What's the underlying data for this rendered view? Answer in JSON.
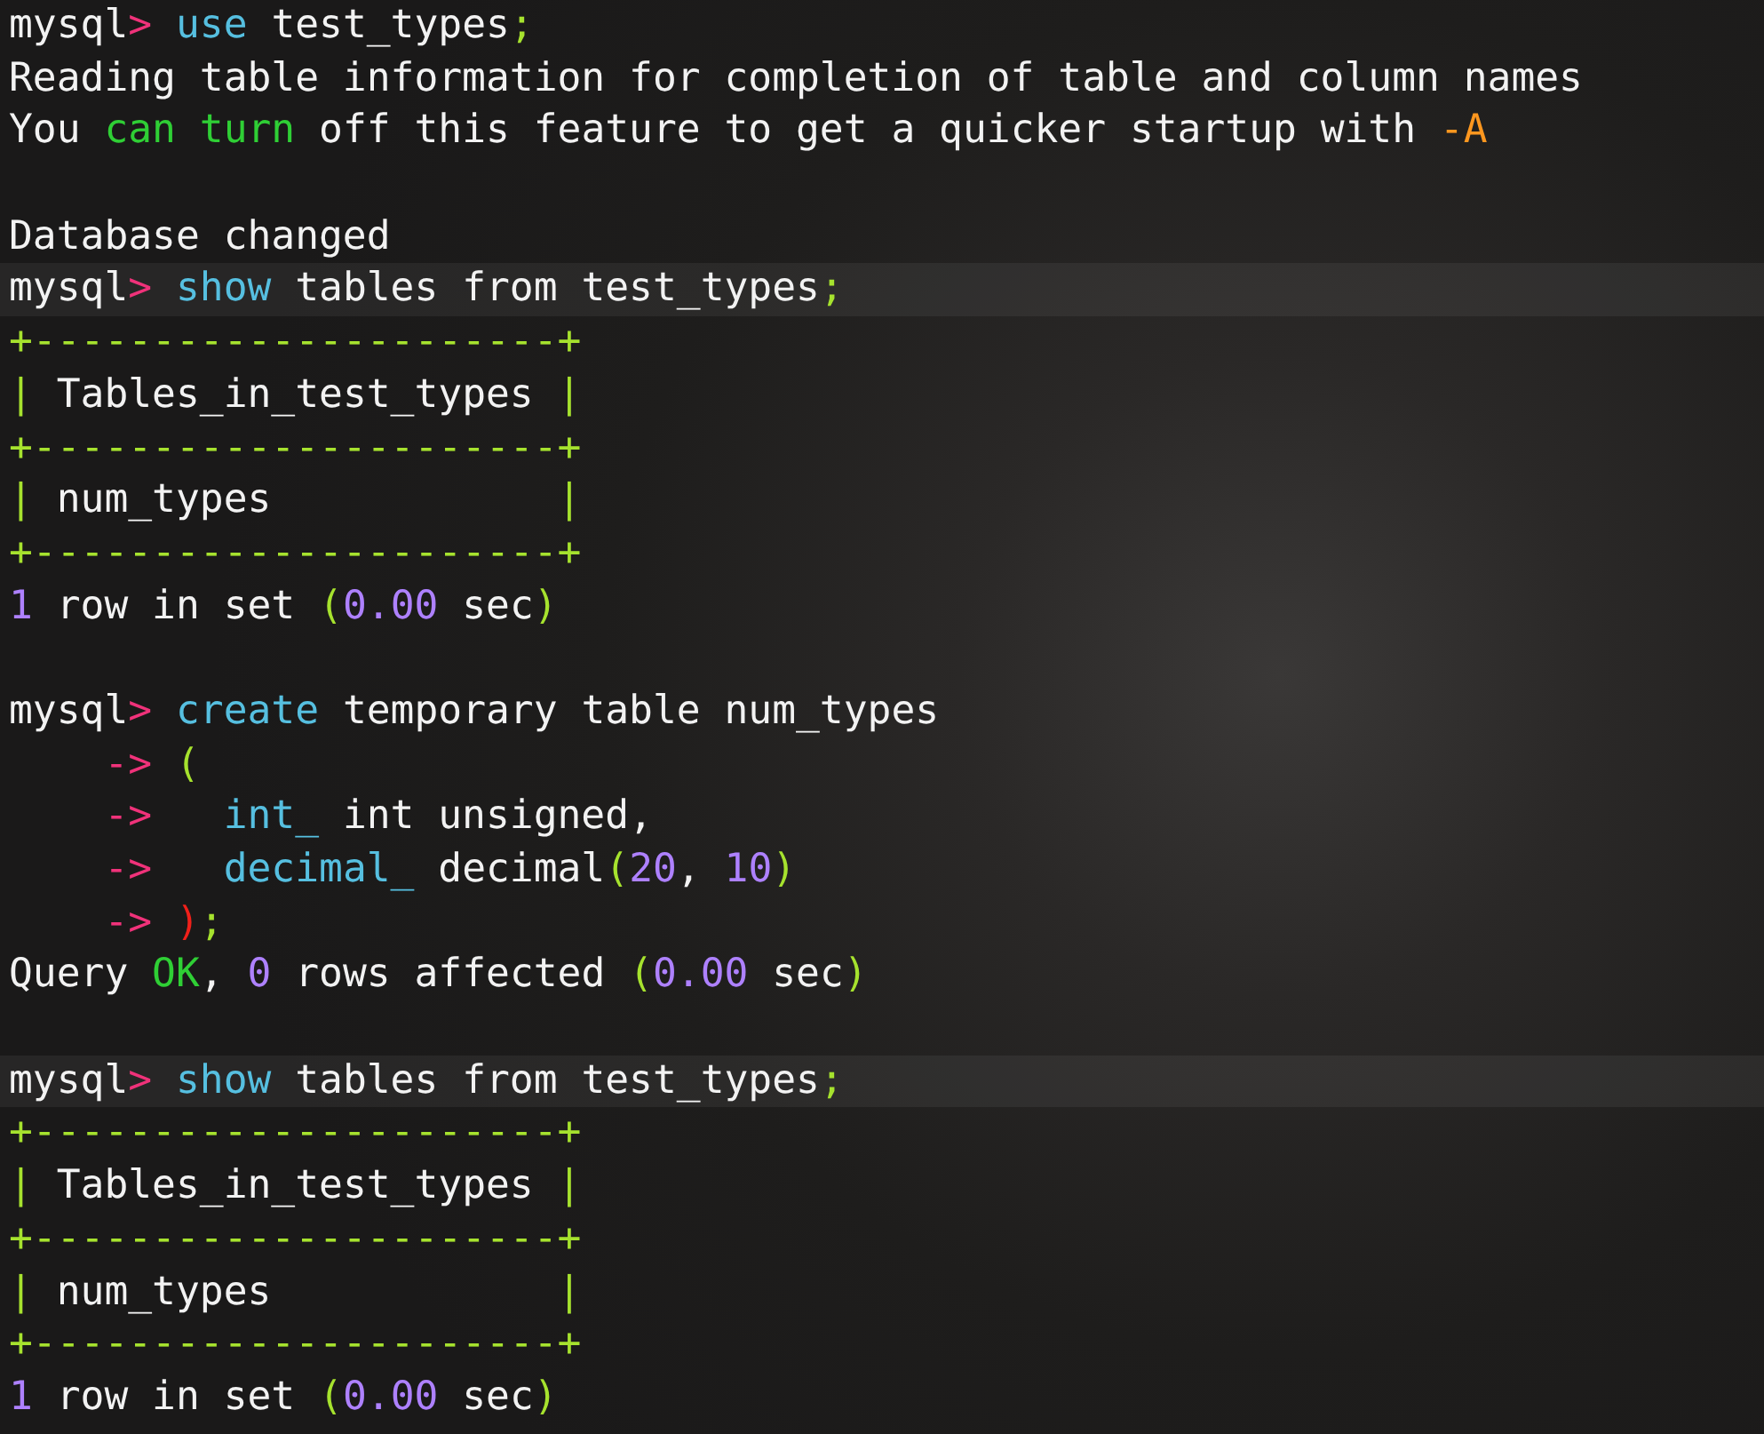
{
  "terminal": {
    "lines": [
      {
        "kind": "code",
        "highlighted": false,
        "segments": [
          {
            "kind": "text",
            "text": "mysql"
          },
          {
            "kind": "prompt",
            "text": ">"
          },
          {
            "kind": "keyword",
            "text": " use"
          },
          {
            "kind": "text",
            "text": " test_types"
          },
          {
            "kind": "punct",
            "text": ";"
          }
        ]
      },
      {
        "kind": "code",
        "highlighted": false,
        "segments": [
          {
            "kind": "text",
            "text": "Reading table information for completion of table and column names"
          }
        ]
      },
      {
        "kind": "code",
        "highlighted": false,
        "segments": [
          {
            "kind": "text",
            "text": "You "
          },
          {
            "kind": "ok",
            "text": "can"
          },
          {
            "kind": "ok",
            "text": " turn"
          },
          {
            "kind": "text",
            "text": " off this feature to get a quicker startup with "
          },
          {
            "kind": "warn",
            "text": "-A"
          }
        ]
      },
      {
        "kind": "blank"
      },
      {
        "kind": "code",
        "highlighted": false,
        "segments": [
          {
            "kind": "text",
            "text": "Database changed"
          }
        ]
      },
      {
        "kind": "code",
        "highlighted": true,
        "segments": [
          {
            "kind": "text",
            "text": "mysql"
          },
          {
            "kind": "prompt",
            "text": ">"
          },
          {
            "kind": "keyword",
            "text": " show"
          },
          {
            "kind": "text",
            "text": " tables from test_types"
          },
          {
            "kind": "punct",
            "text": ";"
          }
        ]
      },
      {
        "kind": "code",
        "highlighted": false,
        "segments": [
          {
            "kind": "border",
            "text": "+----------------------+"
          }
        ]
      },
      {
        "kind": "code",
        "highlighted": false,
        "segments": [
          {
            "kind": "border",
            "text": "|"
          },
          {
            "kind": "text",
            "text": " Tables_in_test_types "
          },
          {
            "kind": "border",
            "text": "|"
          }
        ]
      },
      {
        "kind": "code",
        "highlighted": false,
        "segments": [
          {
            "kind": "border",
            "text": "+----------------------+"
          }
        ]
      },
      {
        "kind": "code",
        "highlighted": false,
        "segments": [
          {
            "kind": "border",
            "text": "|"
          },
          {
            "kind": "text",
            "text": " num_types            "
          },
          {
            "kind": "border",
            "text": "|"
          }
        ]
      },
      {
        "kind": "code",
        "highlighted": false,
        "segments": [
          {
            "kind": "border",
            "text": "+----------------------+"
          }
        ]
      },
      {
        "kind": "code",
        "highlighted": false,
        "segments": [
          {
            "kind": "number",
            "text": "1"
          },
          {
            "kind": "text",
            "text": " row in set "
          },
          {
            "kind": "punct",
            "text": "("
          },
          {
            "kind": "number",
            "text": "0.00"
          },
          {
            "kind": "text",
            "text": " sec"
          },
          {
            "kind": "punct",
            "text": ")"
          }
        ]
      },
      {
        "kind": "blank"
      },
      {
        "kind": "code",
        "highlighted": false,
        "segments": [
          {
            "kind": "text",
            "text": "mysql"
          },
          {
            "kind": "prompt",
            "text": ">"
          },
          {
            "kind": "keyword",
            "text": " create"
          },
          {
            "kind": "text",
            "text": " temporary table num_types"
          }
        ]
      },
      {
        "kind": "code",
        "highlighted": false,
        "segments": [
          {
            "kind": "prompt",
            "text": "    ->"
          },
          {
            "kind": "punct",
            "text": " ("
          }
        ]
      },
      {
        "kind": "code",
        "highlighted": false,
        "segments": [
          {
            "kind": "prompt",
            "text": "    ->"
          },
          {
            "kind": "keyword",
            "text": "   int_"
          },
          {
            "kind": "text",
            "text": " int unsigned,"
          }
        ]
      },
      {
        "kind": "code",
        "highlighted": false,
        "segments": [
          {
            "kind": "prompt",
            "text": "    ->"
          },
          {
            "kind": "keyword",
            "text": "   decimal_"
          },
          {
            "kind": "text",
            "text": " decimal"
          },
          {
            "kind": "punct",
            "text": "("
          },
          {
            "kind": "number",
            "text": "20"
          },
          {
            "kind": "text",
            "text": ", "
          },
          {
            "kind": "number",
            "text": "10"
          },
          {
            "kind": "punct",
            "text": ")"
          }
        ]
      },
      {
        "kind": "code",
        "highlighted": false,
        "segments": [
          {
            "kind": "prompt",
            "text": "    ->"
          },
          {
            "kind": "error",
            "text": " )"
          },
          {
            "kind": "punct",
            "text": ";"
          }
        ]
      },
      {
        "kind": "code",
        "highlighted": false,
        "segments": [
          {
            "kind": "text",
            "text": "Query "
          },
          {
            "kind": "ok",
            "text": "OK"
          },
          {
            "kind": "text",
            "text": ", "
          },
          {
            "kind": "number",
            "text": "0"
          },
          {
            "kind": "text",
            "text": " rows affected "
          },
          {
            "kind": "punct",
            "text": "("
          },
          {
            "kind": "number",
            "text": "0.00"
          },
          {
            "kind": "text",
            "text": " sec"
          },
          {
            "kind": "punct",
            "text": ")"
          }
        ]
      },
      {
        "kind": "blank"
      },
      {
        "kind": "code",
        "highlighted": true,
        "segments": [
          {
            "kind": "text",
            "text": "mysql"
          },
          {
            "kind": "prompt",
            "text": ">"
          },
          {
            "kind": "keyword",
            "text": " show"
          },
          {
            "kind": "text",
            "text": " tables from test_types"
          },
          {
            "kind": "punct",
            "text": ";"
          }
        ]
      },
      {
        "kind": "code",
        "highlighted": false,
        "segments": [
          {
            "kind": "border",
            "text": "+----------------------+"
          }
        ]
      },
      {
        "kind": "code",
        "highlighted": false,
        "segments": [
          {
            "kind": "border",
            "text": "|"
          },
          {
            "kind": "text",
            "text": " Tables_in_test_types "
          },
          {
            "kind": "border",
            "text": "|"
          }
        ]
      },
      {
        "kind": "code",
        "highlighted": false,
        "segments": [
          {
            "kind": "border",
            "text": "+----------------------+"
          }
        ]
      },
      {
        "kind": "code",
        "highlighted": false,
        "segments": [
          {
            "kind": "border",
            "text": "|"
          },
          {
            "kind": "text",
            "text": " num_types            "
          },
          {
            "kind": "border",
            "text": "|"
          }
        ]
      },
      {
        "kind": "code",
        "highlighted": false,
        "segments": [
          {
            "kind": "border",
            "text": "+----------------------+"
          }
        ]
      },
      {
        "kind": "code",
        "highlighted": false,
        "segments": [
          {
            "kind": "number",
            "text": "1"
          },
          {
            "kind": "text",
            "text": " row in set "
          },
          {
            "kind": "punct",
            "text": "("
          },
          {
            "kind": "number",
            "text": "0.00"
          },
          {
            "kind": "text",
            "text": " sec"
          },
          {
            "kind": "punct",
            "text": ")"
          }
        ]
      }
    ]
  }
}
